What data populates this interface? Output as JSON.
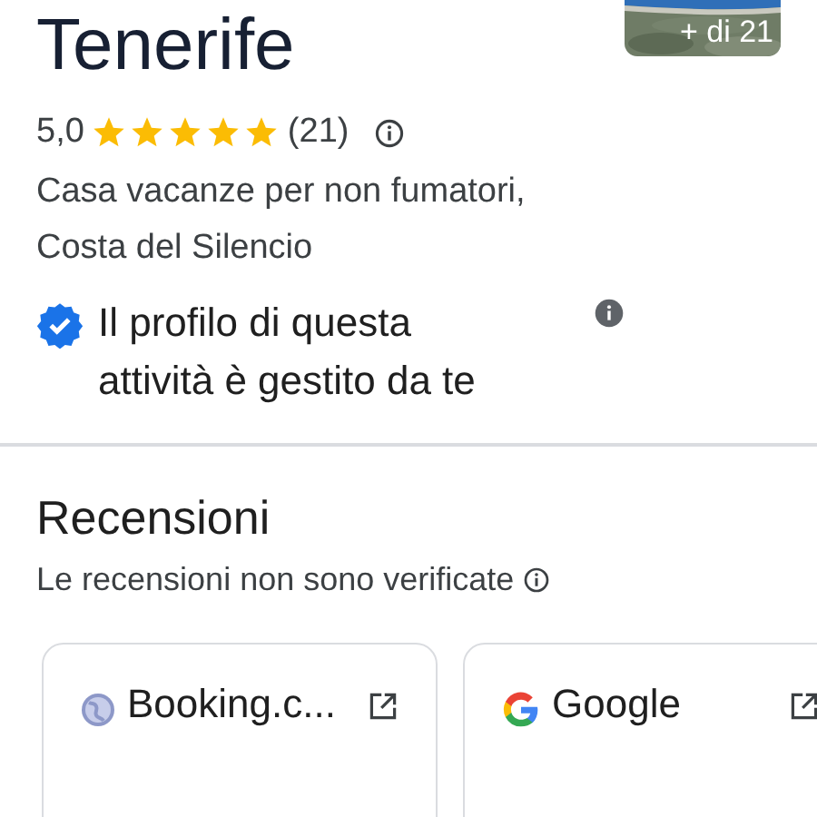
{
  "title": "Tenerife",
  "photos": {
    "kind": "picture",
    "more_label": "+ di 21"
  },
  "rating": {
    "value": "5,0",
    "stars": 5,
    "count": "(21)"
  },
  "category": "Casa vacanze per non fumatori, Costa del Silencio",
  "verified": {
    "checked": true,
    "text": "Il profilo di questa attività è gestito da te"
  },
  "reviews": {
    "title": "Recensioni",
    "note": "Le recensioni non sono verificate",
    "sources": [
      {
        "kind": "globe",
        "name": "Booking.c..."
      },
      {
        "kind": "google",
        "name": "Google"
      }
    ]
  }
}
